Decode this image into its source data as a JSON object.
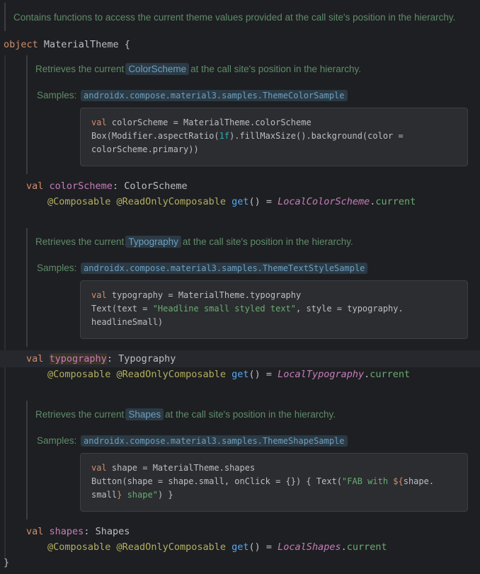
{
  "header_doc": "Contains functions to access the current theme values provided at the call site's position in the hierarchy.",
  "object_decl": {
    "keyword": "object",
    "name": "MaterialTheme",
    "open": "{",
    "close": "}"
  },
  "sections": [
    {
      "doc_prefix": "Retrieves the current",
      "doc_type": "ColorScheme",
      "doc_suffix": "at the call site's position in the hierarchy.",
      "samples_label": "Samples:",
      "sample_link": "androidx.compose.material3.samples.ThemeColorSample",
      "code_lines": [
        {
          "kw": "val",
          "rest": " colorScheme = MaterialTheme.colorScheme"
        },
        {
          "pre": "Box(Modifier.aspectRatio(",
          "lit": "1f",
          "post": ").fillMaxSize().background(color ="
        },
        {
          "pre": "colorScheme.primary))"
        }
      ],
      "decl": {
        "kw": "val",
        "name": "colorScheme",
        "colon": ":",
        "type": "ColorScheme"
      },
      "getter": {
        "ann1": "@Composable",
        "ann2": "@ReadOnlyComposable",
        "get": "get",
        "parens": "() =",
        "local": "LocalColorScheme",
        "dot": ".",
        "current": "current"
      }
    },
    {
      "doc_prefix": "Retrieves the current",
      "doc_type": "Typography",
      "doc_suffix": "at the call site's position in the hierarchy.",
      "samples_label": "Samples:",
      "sample_link": "androidx.compose.material3.samples.ThemeTextStyleSample",
      "code_lines": [
        {
          "kw": "val",
          "rest": " typography = MaterialTheme.typography"
        },
        {
          "pre": "Text(text = ",
          "str": "\"Headline small styled text\"",
          "post": ", style = typography."
        },
        {
          "pre": "headlineSmall)"
        }
      ],
      "decl": {
        "kw": "val",
        "name": "typography",
        "colon": ":",
        "type": "Typography"
      },
      "getter": {
        "ann1": "@Composable",
        "ann2": "@ReadOnlyComposable",
        "get": "get",
        "parens": "() =",
        "local": "LocalTypography",
        "dot": ".",
        "current": "current"
      }
    },
    {
      "doc_prefix": "Retrieves the current",
      "doc_type": "Shapes",
      "doc_suffix": "at the call site's position in the hierarchy.",
      "samples_label": "Samples:",
      "sample_link": "androidx.compose.material3.samples.ThemeShapeSample",
      "code_lines": [
        {
          "kw": "val",
          "rest": " shape = MaterialTheme.shapes"
        },
        {
          "pre": "Button(shape = shape.small, onClick = {}) { Text(",
          "str1": "\"FAB with ",
          "tmpl": "${",
          "mid": "shape.",
          "tail": ""
        },
        {
          "pre": "small",
          "tmpl2": "}",
          "str2": " shape\"",
          ") }": ") }"
        }
      ],
      "decl": {
        "kw": "val",
        "name": "shapes",
        "colon": ":",
        "type": "Shapes"
      },
      "getter": {
        "ann1": "@Composable",
        "ann2": "@ReadOnlyComposable",
        "get": "get",
        "parens": "() =",
        "local": "LocalShapes",
        "dot": ".",
        "current": "current"
      }
    }
  ],
  "colors": {
    "background": "#1e1f22",
    "keyword": "#cf8e6d",
    "property": "#c77dbb",
    "annotation": "#b3ae60",
    "doc": "#5f8c6a",
    "link": "#6e9fbe"
  }
}
